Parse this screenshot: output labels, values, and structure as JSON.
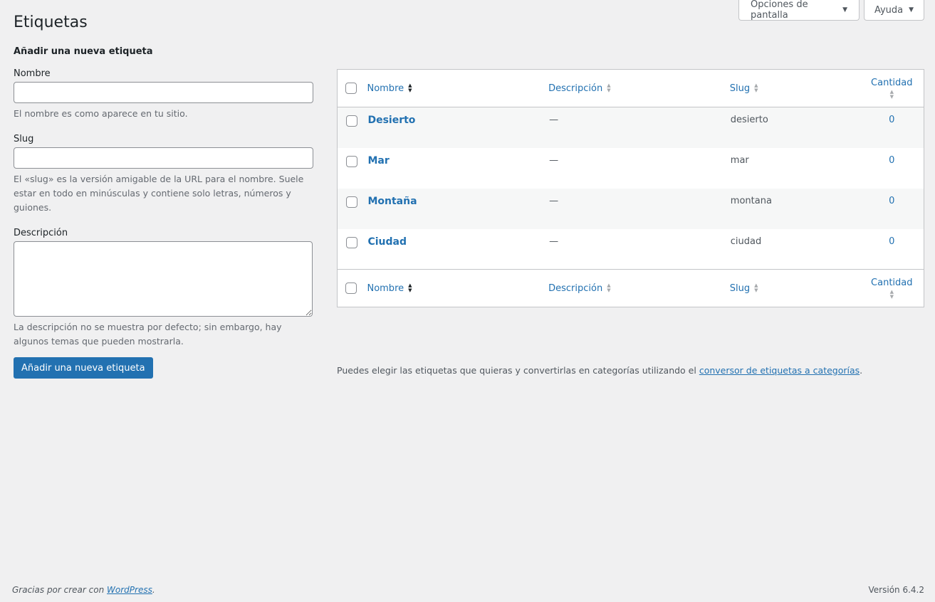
{
  "screen_meta": {
    "screen_options_label": "Opciones de pantalla",
    "help_label": "Ayuda"
  },
  "page_title": "Etiquetas",
  "form": {
    "heading": "Añadir una nueva etiqueta",
    "name_label": "Nombre",
    "name_value": "",
    "name_hint": "El nombre es como aparece en tu sitio.",
    "slug_label": "Slug",
    "slug_value": "",
    "slug_hint": "El «slug» es la versión amigable de la URL para el nombre. Suele estar en todo en minúsculas y contiene solo letras, números y guiones.",
    "description_label": "Descripción",
    "description_value": "",
    "description_hint": "La descripción no se muestra por defecto; sin embargo, hay algunos temas que pueden mostrarla.",
    "submit_label": "Añadir una nueva etiqueta"
  },
  "table": {
    "columns": {
      "name": "Nombre",
      "description": "Descripción",
      "slug": "Slug",
      "count": "Cantidad"
    },
    "rows": [
      {
        "name": "Desierto",
        "description": "—",
        "slug": "desierto",
        "count": "0"
      },
      {
        "name": "Mar",
        "description": "—",
        "slug": "mar",
        "count": "0"
      },
      {
        "name": "Montaña",
        "description": "—",
        "slug": "montana",
        "count": "0"
      },
      {
        "name": "Ciudad",
        "description": "—",
        "slug": "ciudad",
        "count": "0"
      }
    ],
    "note_text": "Puedes elegir las etiquetas que quieras y convertirlas en categorías utilizando el ",
    "note_link": "conversor de etiquetas a categorías",
    "note_end": "."
  },
  "footer": {
    "thanks_text": "Gracias por crear con ",
    "thanks_link": "WordPress",
    "thanks_end": ".",
    "version": "Versión 6.4.2"
  },
  "colors": {
    "accent": "#2271b1",
    "background": "#f0f0f1",
    "text": "#3c434a"
  },
  "icons": {
    "dropdown": "caret-down-icon",
    "sort": "sort-arrows-icon"
  }
}
